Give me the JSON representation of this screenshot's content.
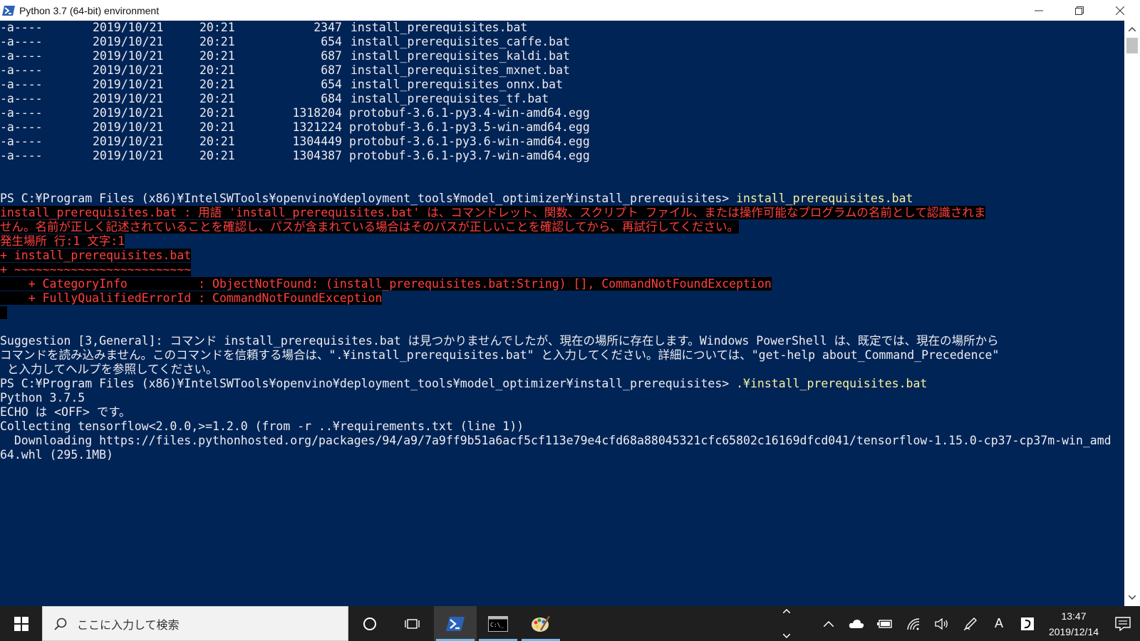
{
  "window": {
    "title": "Python 3.7 (64-bit) environment"
  },
  "console": {
    "listing": [
      {
        "mode": "-a----",
        "date": "2019/10/21",
        "time": "20:21",
        "size": "2347",
        "name": "install_prerequisites.bat"
      },
      {
        "mode": "-a----",
        "date": "2019/10/21",
        "time": "20:21",
        "size": "654",
        "name": "install_prerequisites_caffe.bat"
      },
      {
        "mode": "-a----",
        "date": "2019/10/21",
        "time": "20:21",
        "size": "687",
        "name": "install_prerequisites_kaldi.bat"
      },
      {
        "mode": "-a----",
        "date": "2019/10/21",
        "time": "20:21",
        "size": "687",
        "name": "install_prerequisites_mxnet.bat"
      },
      {
        "mode": "-a----",
        "date": "2019/10/21",
        "time": "20:21",
        "size": "654",
        "name": "install_prerequisites_onnx.bat"
      },
      {
        "mode": "-a----",
        "date": "2019/10/21",
        "time": "20:21",
        "size": "684",
        "name": "install_prerequisites_tf.bat"
      },
      {
        "mode": "-a----",
        "date": "2019/10/21",
        "time": "20:21",
        "size": "1318204",
        "name": "protobuf-3.6.1-py3.4-win-amd64.egg"
      },
      {
        "mode": "-a----",
        "date": "2019/10/21",
        "time": "20:21",
        "size": "1321224",
        "name": "protobuf-3.6.1-py3.5-win-amd64.egg"
      },
      {
        "mode": "-a----",
        "date": "2019/10/21",
        "time": "20:21",
        "size": "1304449",
        "name": "protobuf-3.6.1-py3.6-win-amd64.egg"
      },
      {
        "mode": "-a----",
        "date": "2019/10/21",
        "time": "20:21",
        "size": "1304387",
        "name": "protobuf-3.6.1-py3.7-win-amd64.egg"
      }
    ],
    "prompt1": "PS C:¥Program Files (x86)¥IntelSWTools¥openvino¥deployment_tools¥model_optimizer¥install_prerequisites> ",
    "command1": "install_prerequisites.bat",
    "error_lines": [
      "install_prerequisites.bat : 用語 'install_prerequisites.bat' は、コマンドレット、関数、スクリプト ファイル、または操作可能なプログラムの名前として認識されま",
      "せん。名前が正しく記述されていることを確認し、パスが含まれている場合はそのパスが正しいことを確認してから、再試行してください。",
      "発生場所 行:1 文字:1",
      "+ install_prerequisites.bat",
      "+ ~~~~~~~~~~~~~~~~~~~~~~~~~",
      "    + CategoryInfo          : ObjectNotFound: (install_prerequisites.bat:String) [], CommandNotFoundException",
      "    + FullyQualifiedErrorId : CommandNotFoundException"
    ],
    "suggestion_lines": [
      "Suggestion [3,General]: コマンド install_prerequisites.bat は見つかりませんでしたが、現在の場所に存在します。Windows PowerShell は、既定では、現在の場所から",
      "コマンドを読み込みません。このコマンドを信頼する場合は、\".¥install_prerequisites.bat\" と入力してください。詳細については、\"get-help about_Command_Precedence\"",
      " と入力してヘルプを参照してください。"
    ],
    "prompt2": "PS C:¥Program Files (x86)¥IntelSWTools¥openvino¥deployment_tools¥model_optimizer¥install_prerequisites> ",
    "command2": ".¥install_prerequisites.bat",
    "output_lines": [
      "Python 3.7.5",
      "ECHO は <OFF> です。",
      "Collecting tensorflow<2.0.0,>=1.2.0 (from -r ..¥requirements.txt (line 1))",
      "  Downloading https://files.pythonhosted.org/packages/94/a9/7a9ff9b51a6acf5cf113e79e4cfd68a88045321cfc65802c16169dfcd041/tensorflow-1.15.0-cp37-cp37m-win_amd",
      "64.whl (295.1MB)"
    ]
  },
  "taskbar": {
    "search_placeholder": "ここに入力して検索",
    "clock_time": "13:47",
    "clock_date": "2019/12/14",
    "ime_label": "A",
    "accent_color": "#76b9ed"
  },
  "colors": {
    "console_bg": "#012456",
    "console_fg": "#eeedf0",
    "command_fg": "#f7f3a0",
    "error_fg": "#ff4040",
    "error_bg": "#000000"
  }
}
